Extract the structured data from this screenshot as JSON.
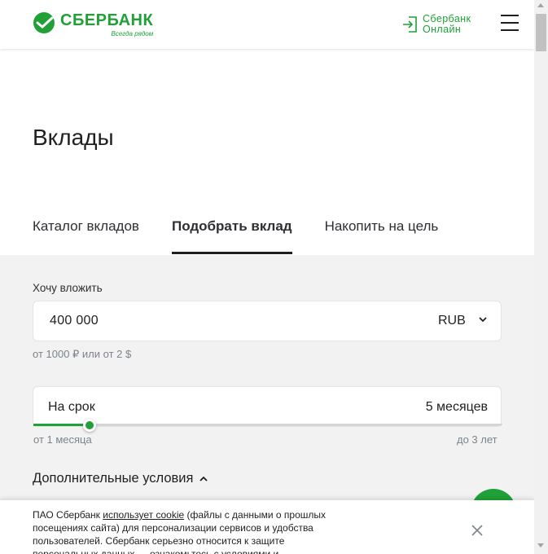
{
  "header": {
    "logo_name": "СБЕРБАНК",
    "logo_tagline": "Всегда рядом",
    "login_line1": "Сбербанк",
    "login_line2": "Онлайн",
    "brand_color": "#21a038"
  },
  "page": {
    "title": "Вклады"
  },
  "tabs": [
    {
      "label": "Каталог вкладов",
      "active": false
    },
    {
      "label": "Подобрать вклад",
      "active": true
    },
    {
      "label": "Накопить на цель",
      "active": false
    }
  ],
  "calculator": {
    "amount_label": "Хочу вложить",
    "amount_value": "400 000",
    "currency": "RUB",
    "amount_hint": "от 1000 ₽ или от 2 $",
    "term_label": "На срок",
    "term_value": "5 месяцев",
    "term_min": "от 1 месяца",
    "term_max": "до 3 лет",
    "term_slider_fraction": 0.12,
    "extra_conditions": "Дополнительные условия"
  },
  "cookie": {
    "text_before": "ПАО Сбербанк ",
    "link": "использует cookie",
    "text_after": " (файлы с данными о прошлых посещениях сайта) для персонализации сервисов и удобства пользователей. Сбербанк серьезно относится к защите персональных данных — ознакомьтесь с условиями и"
  },
  "icons": {
    "logo": "sberbank-logo-icon",
    "login": "login-icon",
    "menu": "hamburger-menu-icon",
    "currency_dropdown": "chevron-down-icon",
    "extra_toggle": "chevron-up-icon",
    "close": "close-icon"
  }
}
